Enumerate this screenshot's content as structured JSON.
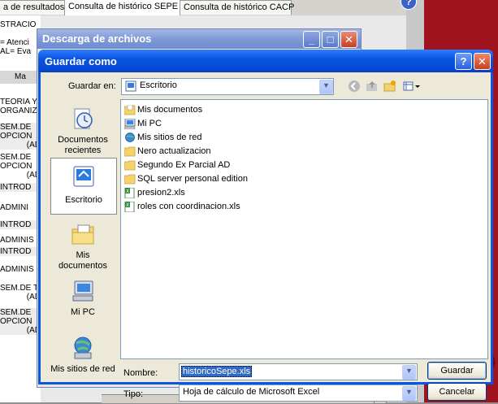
{
  "background": {
    "tabs": [
      {
        "label": "a de resultados"
      },
      {
        "label": "Consulta de histórico SEPE"
      },
      {
        "label": "Consulta de histórico CACP"
      }
    ],
    "fragments": [
      "STRACIO",
      "= Atenci",
      "AL= Eva",
      "Ma",
      "TEORIA Y",
      "ORGANIZ",
      "SEM.DE",
      "OPCION",
      "(AD",
      "SEM.DE",
      "OPCION",
      "(AD",
      "INTROD",
      "ADMINI",
      "INTROD",
      "ADMINIS",
      "INTROD",
      "ADMINIS",
      "SEM.DE T",
      "(AD",
      "SEM.DE",
      "OPCION",
      "(AD"
    ],
    "help_icon": "?"
  },
  "download_window": {
    "title": "Descarga de archivos"
  },
  "dialog": {
    "title": "Guardar como",
    "help_button": "?",
    "close_button": "X",
    "save_in_label": "Guardar en:",
    "save_in_value": "Escritorio",
    "places": [
      {
        "label": "Documentos recientes",
        "icon": "recent-documents-icon"
      },
      {
        "label": "Escritorio",
        "icon": "desktop-icon",
        "selected": true
      },
      {
        "label": "Mis documentos",
        "icon": "my-documents-icon"
      },
      {
        "label": "Mi PC",
        "icon": "my-computer-icon"
      },
      {
        "label": "Mis sitios de red",
        "icon": "network-places-icon"
      }
    ],
    "files": [
      {
        "name": "Mis documentos",
        "icon": "folder-icon"
      },
      {
        "name": "Mi PC",
        "icon": "computer-icon"
      },
      {
        "name": "Mis sitios de red",
        "icon": "network-icon"
      },
      {
        "name": "Nero actualizacion",
        "icon": "folder-icon"
      },
      {
        "name": "Segundo Ex Parcial AD",
        "icon": "folder-icon"
      },
      {
        "name": "SQL server personal edition",
        "icon": "folder-icon"
      },
      {
        "name": "presion2.xls",
        "icon": "excel-file-icon"
      },
      {
        "name": "roles con coordinacion.xls",
        "icon": "excel-file-icon"
      }
    ],
    "filename_label": "Nombre:",
    "filename_value": "historicoSepe.xls",
    "type_label": "Tipo:",
    "type_value": "Hoja de cálculo de Microsoft Excel",
    "save_button": "Guardar",
    "cancel_button": "Cancelar"
  }
}
